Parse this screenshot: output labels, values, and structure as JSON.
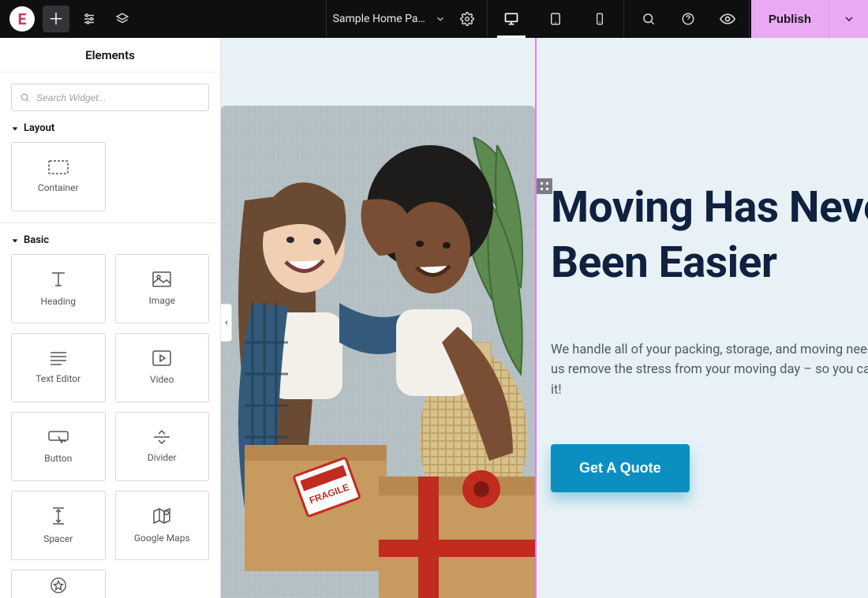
{
  "topbar": {
    "page_title": "Sample Home Pa…",
    "publish_label": "Publish"
  },
  "sidebar": {
    "title": "Elements",
    "search_placeholder": "Search Widget...",
    "categories": {
      "layout": {
        "label": "Layout",
        "widgets": {
          "container": "Container"
        }
      },
      "basic": {
        "label": "Basic",
        "widgets": {
          "heading": "Heading",
          "image": "Image",
          "text_editor": "Text Editor",
          "video": "Video",
          "button": "Button",
          "divider": "Divider",
          "spacer": "Spacer",
          "google_maps": "Google Maps"
        }
      }
    }
  },
  "canvas": {
    "hero": {
      "heading_line1": "Moving Has Never",
      "heading_line2": "Been Easier",
      "paragraph": "We handle all of your packing, storage, and moving needs. Let us remove the stress from your moving day – so you can enjoy it!",
      "cta_label": "Get A Quote"
    }
  }
}
